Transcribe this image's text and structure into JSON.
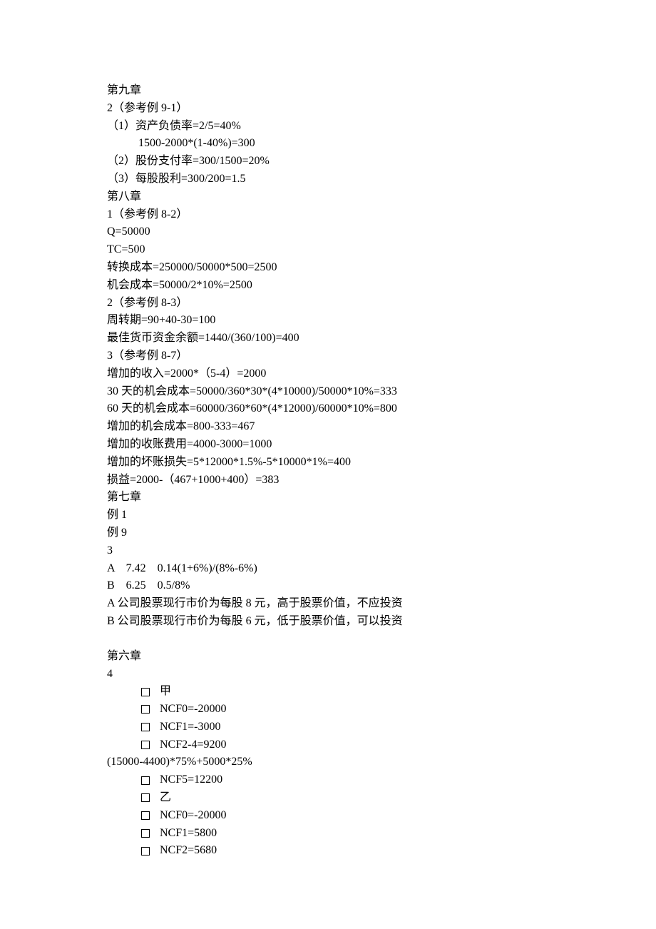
{
  "lines": [
    "第九章",
    "2（参考例 9-1）",
    "（1）资产负债率=2/5=40%",
    "           1500-2000*(1-40%)=300",
    "（2）股份支付率=300/1500=20%",
    "（3）每股股利=300/200=1.5",
    "第八章",
    "1（参考例 8-2）",
    "Q=50000",
    "TC=500",
    "转换成本=250000/50000*500=2500",
    "机会成本=50000/2*10%=2500",
    "2（参考例 8-3）",
    "周转期=90+40-30=100",
    "最佳货币资金余额=1440/(360/100)=400",
    "3（参考例 8-7）",
    "增加的收入=2000*（5-4）=2000",
    "30 天的机会成本=50000/360*30*(4*10000)/50000*10%=333",
    "60 天的机会成本=60000/360*60*(4*12000)/60000*10%=800",
    "增加的机会成本=800-333=467",
    "增加的收账费用=4000-3000=1000",
    "增加的坏账损失=5*12000*1.5%-5*10000*1%=400",
    "损益=2000-（467+1000+400）=383",
    "第七章",
    "例 1",
    "例 9",
    "3",
    "A    7.42    0.14(1+6%)/(8%-6%)",
    "B    6.25    0.5/8%",
    "A 公司股票现行市价为每股 8 元，高于股票价值，不应投资",
    "B 公司股票现行市价为每股 6 元，低于股票价值，可以投资"
  ],
  "chapter6_heading": "第六章",
  "chapter6_num": "4",
  "bullets1": [
    "甲",
    "NCF0=-20000",
    "NCF1=-3000",
    "NCF2-4=9200"
  ],
  "midline": "(15000-4400)*75%+5000*25%",
  "bullets2": [
    "NCF5=12200",
    "乙",
    "NCF0=-20000",
    "NCF1=5800",
    "NCF2=5680"
  ]
}
